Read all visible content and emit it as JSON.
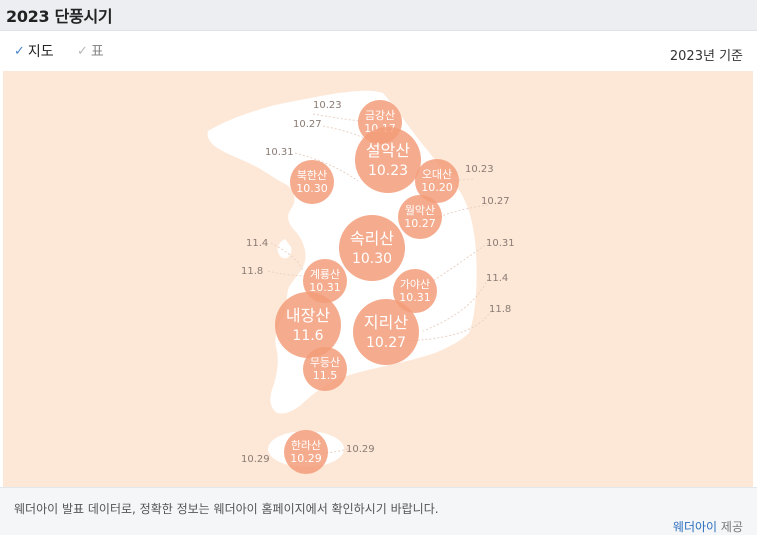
{
  "header": {
    "title": "2023 단풍시기"
  },
  "tabs": {
    "map_label": "지도",
    "table_label": "표",
    "check_glyph": "✓",
    "basis": "2023년 기준"
  },
  "colors": {
    "land": "#ffffff",
    "sea": "#fde8d8",
    "bubble": "#f39c79",
    "bubble_fill_opacity": 0.85,
    "bubble_text": "#ffffff",
    "date_text": "#8a7b73",
    "guide_line": "#e9d2c4"
  },
  "mountains": [
    {
      "name": "금강산",
      "date": "10.17",
      "size": "small"
    },
    {
      "name": "설악산",
      "date": "10.23",
      "size": "large"
    },
    {
      "name": "오대산",
      "date": "10.20",
      "size": "small"
    },
    {
      "name": "북한산",
      "date": "10.30",
      "size": "small"
    },
    {
      "name": "월악산",
      "date": "10.27",
      "size": "small"
    },
    {
      "name": "속리산",
      "date": "10.30",
      "size": "large"
    },
    {
      "name": "계룡산",
      "date": "10.31",
      "size": "small"
    },
    {
      "name": "가야산",
      "date": "10.31",
      "size": "small"
    },
    {
      "name": "내장산",
      "date": "11.6",
      "size": "large"
    },
    {
      "name": "지리산",
      "date": "10.27",
      "size": "large"
    },
    {
      "name": "무등산",
      "date": "11.5",
      "size": "small"
    },
    {
      "name": "한라산",
      "date": "10.29",
      "size": "small"
    }
  ],
  "guide_labels": [
    "10.23",
    "10.27",
    "10.31",
    "11.4",
    "11.8",
    "10.23",
    "10.27",
    "10.31",
    "11.4",
    "11.8",
    "10.29",
    "10.29"
  ],
  "footer": {
    "note": "웨더아이 발표 데이터로, 정확한 정보는 웨더아이 홈페이지에서 확인하시기 바랍니다.",
    "credit_link": "웨더아이",
    "credit_suffix": "제공"
  }
}
